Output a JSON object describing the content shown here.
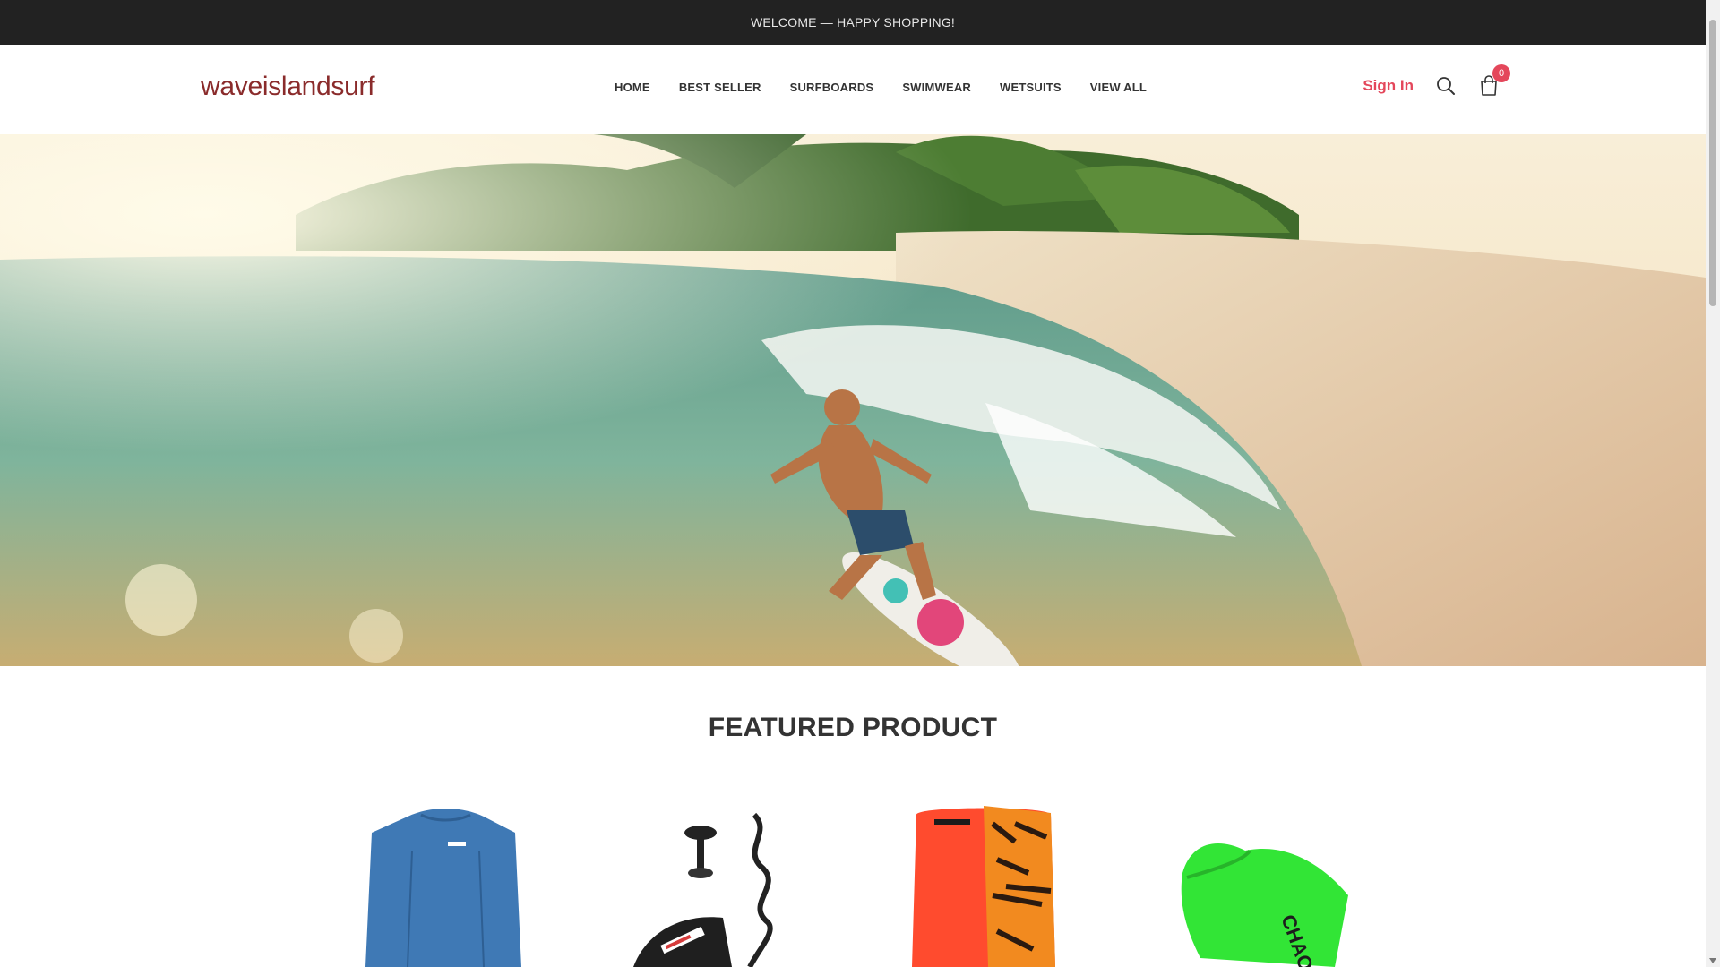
{
  "topbar": {
    "message": "WELCOME — HAPPY SHOPPING!"
  },
  "header": {
    "logo": "waveislandsurf",
    "nav": [
      "HOME",
      "BEST SELLER",
      "SURFBOARDS",
      "SWIMWEAR",
      "WETSUITS",
      "VIEW ALL"
    ],
    "sign_in": "Sign In",
    "cart_count": "0",
    "icons": {
      "search": "search-icon",
      "cart": "shopping-bag-icon"
    },
    "accent_color": "#e4475b",
    "logo_color": "#8a2b2b"
  },
  "hero": {
    "image": "surfer-riding-wave-tropical-beach"
  },
  "featured": {
    "title": "FEATURED PRODUCT",
    "products": [
      {
        "image": "blue-long-sleeve-rash-guard"
      },
      {
        "image": "bodyboard-coiled-leash"
      },
      {
        "image": "orange-tiger-stripe-bodyboard"
      },
      {
        "image": "green-chaos-bodyboard"
      }
    ]
  }
}
